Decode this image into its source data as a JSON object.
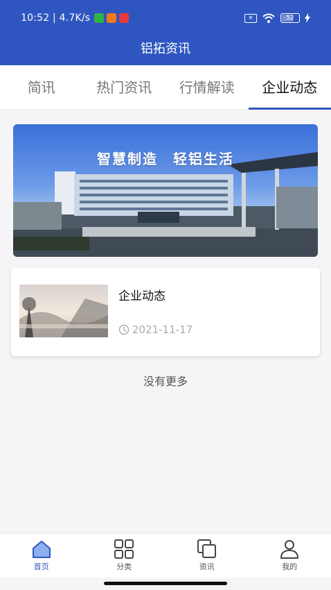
{
  "status_bar": {
    "time": "10:52",
    "speed": "4.7K/s",
    "battery": "52"
  },
  "header": {
    "title": "铝拓资讯"
  },
  "tabs": [
    {
      "label": "简讯"
    },
    {
      "label": "热门资讯"
    },
    {
      "label": "行情解读"
    },
    {
      "label": "企业动态",
      "active": true
    }
  ],
  "banner": {
    "slogan": "智慧制造　轻铝生活"
  },
  "articles": [
    {
      "title": "企业动态",
      "date": "2021-11-17"
    }
  ],
  "list_footer": "没有更多",
  "bottom_nav": [
    {
      "label": "首页",
      "icon": "home-icon",
      "active": true
    },
    {
      "label": "分类",
      "icon": "grid-icon"
    },
    {
      "label": "资讯",
      "icon": "copy-icon"
    },
    {
      "label": "我的",
      "icon": "user-icon"
    }
  ],
  "colors": {
    "brand": "#2f56c0"
  }
}
